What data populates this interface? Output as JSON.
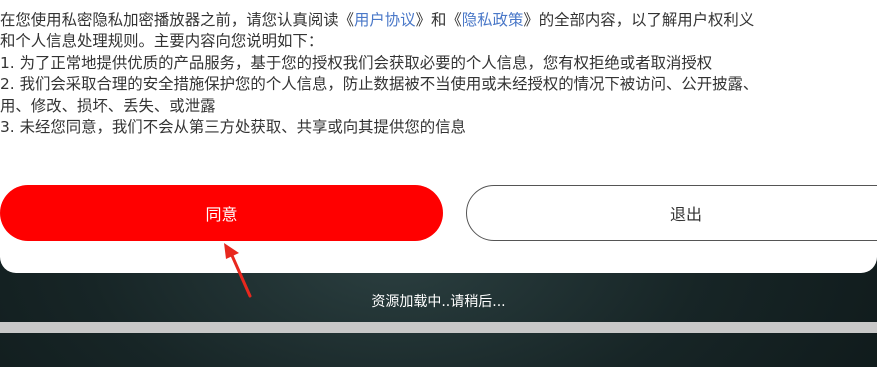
{
  "privacy_dialog": {
    "notice": {
      "line1_prefix": "在您使用私密隐私加密播放器之前，请您认真阅读《",
      "user_agreement_link": "用户协议",
      "line1_middle": "》和《",
      "privacy_policy_link": "隐私政策",
      "line1_suffix": "》的全部内容，以了解用户权利义",
      "line2": "和个人信息处理规则。主要内容向您说明如下：",
      "line3": "1. 为了正常地提供优质的产品服务，基于您的授权我们会获取必要的个人信息，您有权拒绝或者取消授权",
      "line4": "2. 我们会采取合理的安全措施保护您的个人信息，防止数据被不当使用或未经授权的情况下被访问、公开披露、",
      "line5": "用、修改、损坏、丢失、或泄露",
      "line6": "3. 未经您同意，我们不会从第三方处获取、共享或向其提供您的信息"
    },
    "agree_label": "同意",
    "exit_label": "退出"
  },
  "loading": {
    "text": "资源加载中..请稍后...",
    "progress": 1.0
  },
  "colors": {
    "agree_button": "#ff0000",
    "link": "#4a78c8",
    "annotation_arrow": "#e8281e",
    "progress_bar": "#c8c8c8"
  }
}
